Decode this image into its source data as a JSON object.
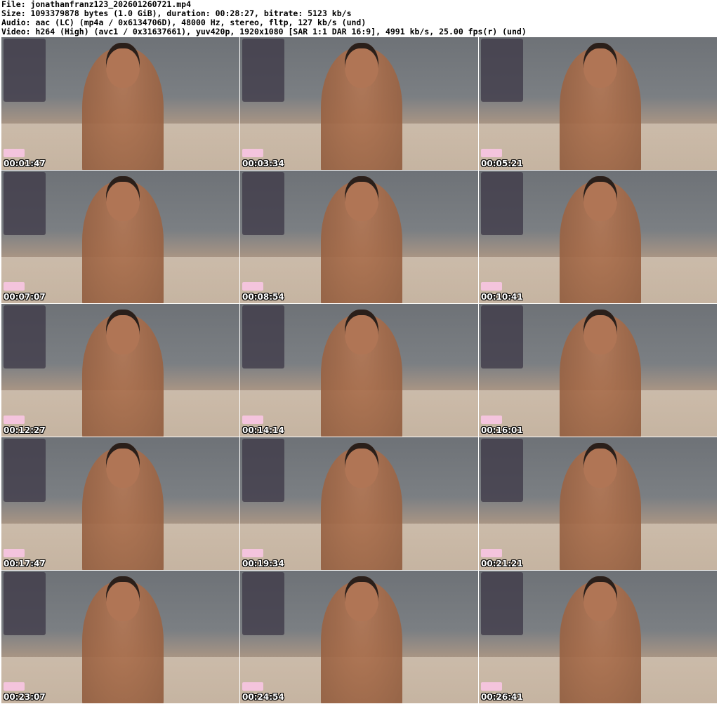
{
  "header": {
    "file": "File: jonathanfranz123_202601260721.mp4",
    "size": "Size: 1093379878 bytes (1.0 GiB), duration: 00:28:27, bitrate: 5123 kb/s",
    "audio": "Audio: aac (LC) (mp4a / 0x6134706D), 48000 Hz, stereo, fltp, 127 kb/s (und)",
    "video": "Video: h264 (High) (avc1 / 0x31637661), yuv420p, 1920x1080 [SAR 1:1 DAR 16:9], 4991 kb/s, 25.00 fps(r) (und)"
  },
  "thumbnails": [
    {
      "timestamp": "00:01:47"
    },
    {
      "timestamp": "00:03:34"
    },
    {
      "timestamp": "00:05:21"
    },
    {
      "timestamp": "00:07:07"
    },
    {
      "timestamp": "00:08:54"
    },
    {
      "timestamp": "00:10:41"
    },
    {
      "timestamp": "00:12:27"
    },
    {
      "timestamp": "00:14:14"
    },
    {
      "timestamp": "00:16:01"
    },
    {
      "timestamp": "00:17:47"
    },
    {
      "timestamp": "00:19:34"
    },
    {
      "timestamp": "00:21:21"
    },
    {
      "timestamp": "00:23:07"
    },
    {
      "timestamp": "00:24:54"
    },
    {
      "timestamp": "00:26:41"
    }
  ]
}
